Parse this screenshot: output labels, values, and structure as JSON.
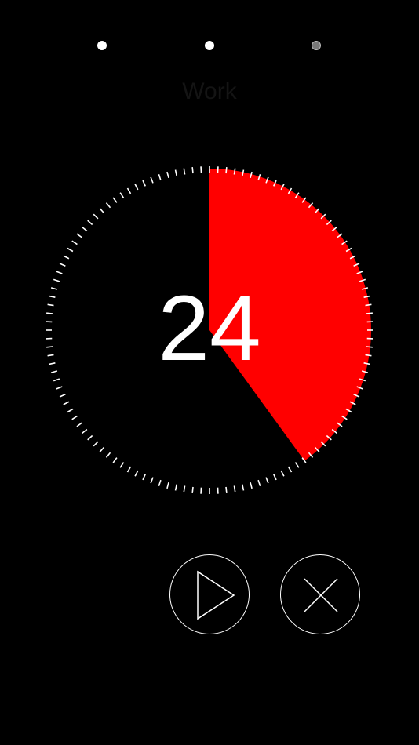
{
  "pager": {
    "pages": [
      {
        "active": true
      },
      {
        "active": true
      },
      {
        "active": false
      }
    ]
  },
  "mode": {
    "title": "Work"
  },
  "timer": {
    "remaining_minutes": "24",
    "progress_fraction": 0.4,
    "accent_color": "#ff0000",
    "tick_color": "#ffffff",
    "tick_count": 120
  },
  "controls": {
    "play_icon": "play-icon",
    "cancel_icon": "close-icon"
  }
}
